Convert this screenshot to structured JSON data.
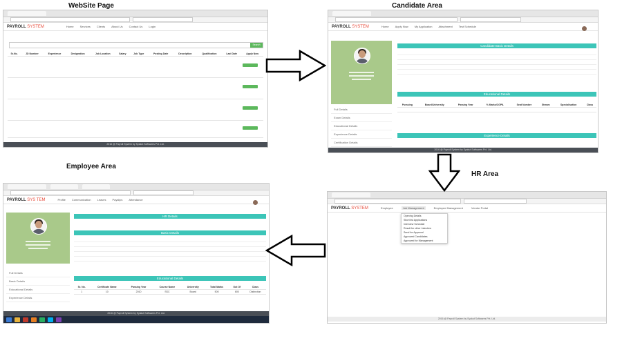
{
  "captions": {
    "website": "WebSite Page",
    "candidate": "Candidate Area",
    "employee": "Employee Area",
    "hr": "HR Area"
  },
  "brand": {
    "prefix": "PAYROLL ",
    "suffix": "SYSTEM",
    "employee_prefix": "PAYROLL ",
    "employee_suffix": "SYS TEM"
  },
  "website": {
    "nav": [
      "Home",
      "Services",
      "Clients",
      "About Us",
      "Contact Us",
      "Login"
    ],
    "search_button": "Search",
    "table_headers": [
      "Sr.No.",
      "JD Number",
      "Experience",
      "Designation",
      "Job Location",
      "Salary",
      "Job Type",
      "Posting Date",
      "Description",
      "Qualification",
      "Last Date",
      "Apply Now"
    ],
    "footer": "2016 @ Payroll System by Syakut Softwares Pvt. Ltd."
  },
  "candidate": {
    "nav": [
      "Home",
      "Apply Now",
      "My Application",
      "Attachment",
      "Test Schedule"
    ],
    "side_menu": [
      "Full Details",
      "Exam Details",
      "Educational Details",
      "Experience Details",
      "Certification Details"
    ],
    "sections": {
      "basic": "Candidate Basic Details",
      "education": "Educational Details",
      "experience": "Experience Details"
    },
    "edu_headers": [
      "Pursuing",
      "Board/University",
      "Passing Year",
      "% Marks/CGPA",
      "Seat Number",
      "Stream",
      "Specialisation",
      "Class"
    ],
    "footer": "2016 @ Payroll System by Syakut Softwares Pvt. Ltd."
  },
  "employee": {
    "nav": [
      "Profile",
      "Communication",
      "Leaves",
      "Payslips",
      "Attendance"
    ],
    "side_menu": [
      "Full Details",
      "Basic Details",
      "Educational Details",
      "Experience Details"
    ],
    "sections": {
      "top": "HR Details",
      "basic": "Basic Details",
      "education": "Educational Details"
    },
    "edu_headers": [
      "Sr. No.",
      "Certificate Name",
      "Passing Year",
      "Course Name",
      "University",
      "Total Marks",
      "Out Of",
      "Class"
    ],
    "edu_row": [
      "1",
      "10",
      "2010",
      "SSC",
      "Board",
      "500",
      "600",
      "Distinction"
    ],
    "footer": "2016 @ Payroll System by Syakut Softwares Pvt. Ltd."
  },
  "hr": {
    "nav": [
      "Employee",
      "Job Management",
      "Employee Management",
      "Vendor Portal"
    ],
    "dropdown": [
      "Opening Details",
      "Short list Applications",
      "Interview Schedule",
      "Result for other Interview",
      "Send for Approval",
      "Approved Candidates",
      "Approved for Management"
    ],
    "footer": "2016 @ Payroll System by Syakut Softwares Pvt. Ltd."
  },
  "colors": {
    "teal": "#3cc5b8",
    "profile_green": "#a9c98a",
    "footer": "#4a4f56",
    "brand_red": "#e74c3c",
    "apply_green": "#5cb85c"
  }
}
